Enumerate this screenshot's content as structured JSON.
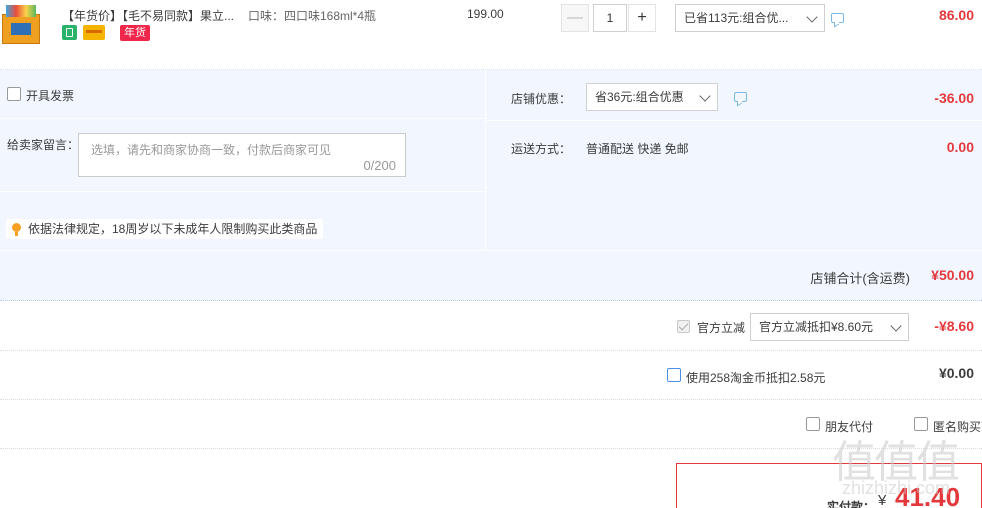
{
  "product": {
    "title": "【年货价】【毛不易同款】果立...",
    "spec": "口味：四口味168ml*4瓶",
    "badge_label": "年货",
    "unit_price": "199.00",
    "quantity": "1",
    "minus_label": "—",
    "plus_label": "+",
    "promo_selected": "已省113元:组合优...",
    "subtotal": "86.00"
  },
  "invoice": {
    "label": "开具发票"
  },
  "message": {
    "label": "给卖家留言：",
    "placeholder": "选填，请先和商家协商一致，付款后商家可见",
    "counter": "0/200"
  },
  "law_notice": "依据法律规定，18周岁以下未成年人限制购买此类商品",
  "shop_discount": {
    "label": "店铺优惠：",
    "selected": "省36元:组合优惠",
    "amount": "-36.00"
  },
  "shipping": {
    "label": "运送方式：",
    "method": "普通配送 快递 免邮",
    "amount": "0.00"
  },
  "shop_total": {
    "label": "店铺合计(含运费)",
    "amount": "¥50.00"
  },
  "official_discount": {
    "label": "官方立减",
    "selected": "官方立减抵扣¥8.60元",
    "amount": "-¥8.60"
  },
  "taobao_coin": {
    "label": "使用258淘金币抵扣2.58元",
    "amount": "¥0.00"
  },
  "options": {
    "friend_pay": "朋友代付",
    "anonymous": "匿名购买"
  },
  "payment": {
    "label": "实付款：",
    "currency": "¥",
    "amount": "41.40"
  },
  "watermark": {
    "chars": "值值值",
    "url": "zhizhizhi.com"
  },
  "colors": {
    "accent_red": "#e4393c",
    "panel_blue": "#f2f7ff",
    "badge_red": "#f0264a"
  },
  "icons": [
    "product-thumbnail",
    "guarantee-icon",
    "card-icon",
    "chat-icon",
    "bulb-icon",
    "chevron-down-icon"
  ]
}
